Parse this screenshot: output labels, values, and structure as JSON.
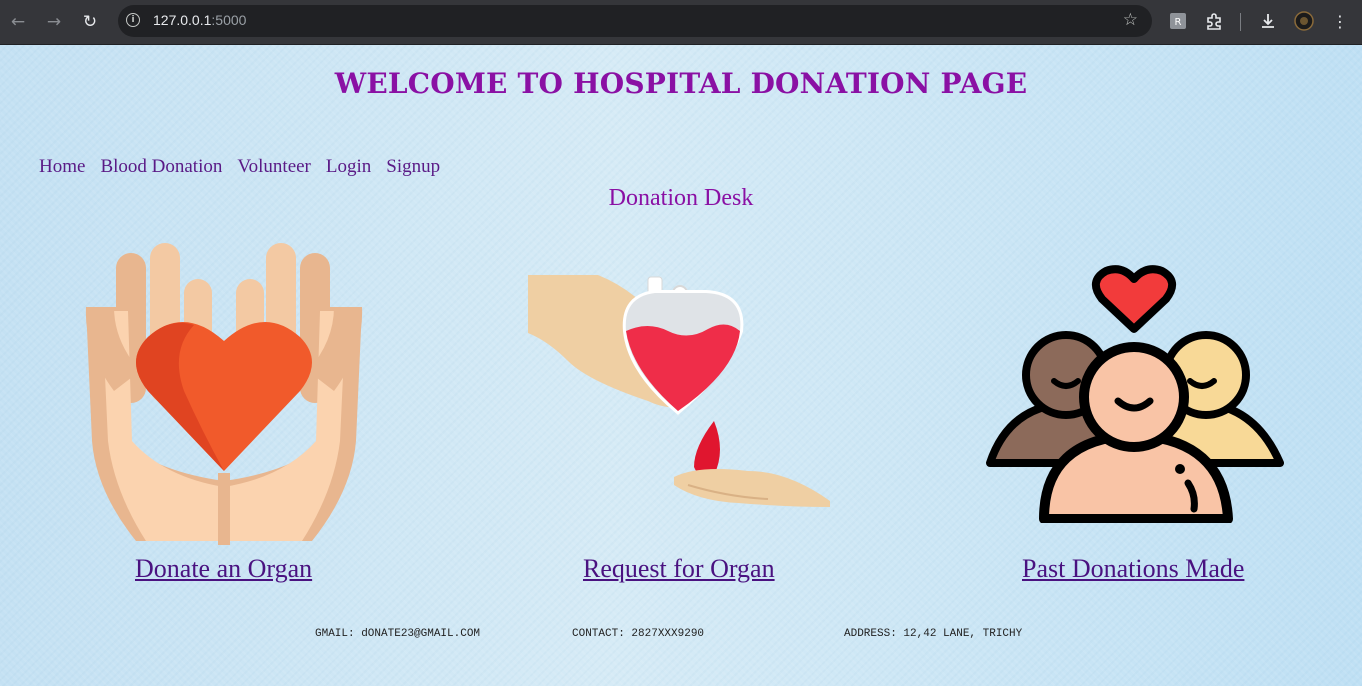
{
  "browser": {
    "url_host": "127.0.0.1",
    "url_port": ":5000",
    "back_icon": "arrow-left-icon",
    "forward_icon": "arrow-right-icon",
    "reload_icon": "reload-icon"
  },
  "page": {
    "title": "WELCOME TO HOSPITAL DONATION PAGE",
    "nav": {
      "home": "Home",
      "blood_donation": "Blood Donation",
      "volunteer": "Volunteer",
      "login": "Login",
      "signup": "Signup"
    },
    "section_title": "Donation Desk",
    "cards": {
      "donate_label": "Donate an Organ",
      "request_label": "Request for Organ",
      "past_label": "Past Donations Made"
    },
    "footer": {
      "gmail": "GMAIL: dONATE23@GMAIL.COM",
      "contact": "CONTACT: 2827XXX9290",
      "address": "ADDRESS: 12,42 LANE, TRICHY"
    }
  },
  "colors": {
    "title": "#8a10a4",
    "nav_link": "#5a1a86",
    "card_link": "#4a1280"
  }
}
